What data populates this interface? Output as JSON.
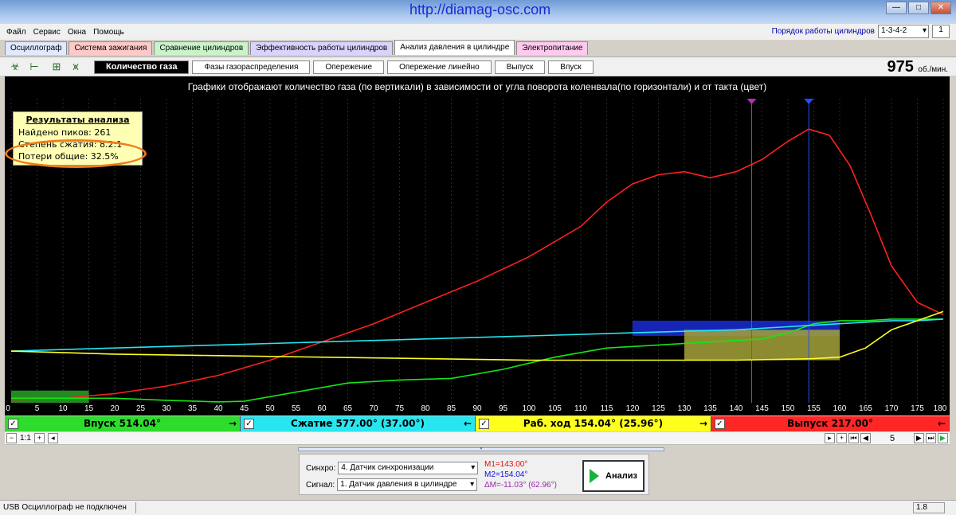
{
  "window": {
    "url": "http://diamag-osc.com"
  },
  "menu": [
    "Файл",
    "Сервис",
    "Окна",
    "Помощь"
  ],
  "cylinder_order": {
    "label": "Порядок работы цилиндров",
    "value": "1-3-4-2",
    "spin": "1"
  },
  "main_tabs": [
    {
      "label": "Осциллограф",
      "color": "#dfe9ff"
    },
    {
      "label": "Система зажигания",
      "color": "#ffc9c9"
    },
    {
      "label": "Сравнение цилиндров",
      "color": "#c9f4c9"
    },
    {
      "label": "Эффективность работы цилиндров",
      "color": "#d9d4ff"
    },
    {
      "label": "Анализ давления в цилиндре",
      "color": "#ffffff"
    },
    {
      "label": "Электропитание",
      "color": "#ffc9f0"
    }
  ],
  "sub_tabs": [
    "Количество газа",
    "Фазы газораспределения",
    "Опережение",
    "Опережение линейно",
    "Выпуск",
    "Впуск"
  ],
  "rpm": {
    "value": "975",
    "unit": "об./мин."
  },
  "chart_caption": "Графики отображают количество газа (по вертикали) в зависимости от угла поворота коленвала(по горизонтали) и от такта (цвет)",
  "results": {
    "title": "Результаты анализа",
    "peaks": "Найдено пиков: 261",
    "compression": "Степень сжатия: 8.2:1",
    "losses": "Потери общие: 32.5%"
  },
  "phases": [
    {
      "label": "Впуск 514.04°",
      "color": "#2ddc2d",
      "arrow": "→"
    },
    {
      "label": "Сжатие 577.00° (37.00°)",
      "color": "#28e6f0",
      "arrow": "←"
    },
    {
      "label": "Раб. ход 154.04° (25.96°)",
      "color": "#ffff1e",
      "arrow": "→"
    },
    {
      "label": "Выпуск 217.00°",
      "color": "#ff2626",
      "arrow": "←"
    }
  ],
  "nav": {
    "scale": "1:1",
    "page": "5"
  },
  "controls": {
    "sync_label": "Синхро:",
    "sync_value": "4.  Датчик синхронизации",
    "signal_label": "Сигнал:",
    "signal_value": "1.  Датчик давления в цилиндре",
    "m1": "M1=143.00°",
    "m2": "M2=154.04°",
    "dm": "ΔM=-11.03° (62.96°)",
    "analyze_label": "Анализ"
  },
  "status": {
    "text": "USB Осциллограф не подключен",
    "version": "1.8"
  },
  "chart_data": {
    "type": "line",
    "title": "",
    "xlim": [
      0,
      180
    ],
    "ylim": [
      0,
      100
    ],
    "x_ticks": [
      0,
      5,
      10,
      15,
      20,
      25,
      30,
      35,
      40,
      45,
      50,
      55,
      60,
      65,
      70,
      75,
      80,
      85,
      90,
      95,
      100,
      105,
      110,
      115,
      120,
      125,
      130,
      135,
      140,
      145,
      150,
      155,
      160,
      165,
      170,
      175,
      180
    ],
    "markers": {
      "m1": 143.0,
      "m2": 154.04
    },
    "series": [
      {
        "color": "#ff2020",
        "x": [
          0,
          10,
          20,
          30,
          40,
          50,
          60,
          70,
          80,
          90,
          100,
          110,
          115,
          120,
          125,
          130,
          135,
          140,
          145,
          150,
          154,
          158,
          162,
          166,
          170,
          175,
          180
        ],
        "y": [
          1,
          1.5,
          3,
          5.5,
          9,
          14,
          20,
          26,
          33,
          40,
          48,
          58,
          66,
          72,
          75,
          76,
          74,
          76,
          80,
          86,
          90,
          88,
          78,
          62,
          45,
          33,
          29
        ]
      },
      {
        "color": "#14e614",
        "x": [
          0,
          10,
          20,
          30,
          40,
          45,
          55,
          65,
          75,
          85,
          95,
          105,
          115,
          125,
          135,
          145,
          150,
          155,
          160,
          165,
          170,
          175,
          180
        ],
        "y": [
          1.5,
          1.5,
          1.5,
          0.8,
          0.3,
          0.5,
          3.5,
          6.5,
          7.5,
          8,
          11,
          15,
          18,
          19,
          20,
          21,
          23,
          26,
          27,
          27,
          27.5,
          27.5,
          27.5
        ]
      },
      {
        "color": "#24e6ef",
        "x": [
          0,
          20,
          40,
          60,
          80,
          100,
          120,
          140,
          150,
          160,
          165,
          170,
          175,
          180
        ],
        "y": [
          17,
          18,
          19,
          20,
          21,
          22,
          23,
          24,
          25,
          26,
          26.5,
          27,
          27,
          27.5
        ]
      },
      {
        "color": "#ffff22",
        "x": [
          0,
          20,
          40,
          60,
          80,
          100,
          120,
          140,
          155,
          160,
          165,
          170,
          175,
          180
        ],
        "y": [
          17,
          16,
          15.5,
          15,
          14.5,
          14,
          14,
          14,
          14.5,
          15,
          18,
          24,
          27,
          30
        ]
      }
    ],
    "shaded": [
      {
        "color": "#27a327",
        "x0": 0,
        "x1": 15,
        "y0": 0,
        "y1": 4
      },
      {
        "color": "#1b2bd6",
        "x0": 120,
        "x1": 160,
        "y0": 22,
        "y1": 27
      },
      {
        "color": "#a6a33a",
        "x0": 130,
        "x1": 160,
        "y0": 14,
        "y1": 24
      }
    ]
  }
}
